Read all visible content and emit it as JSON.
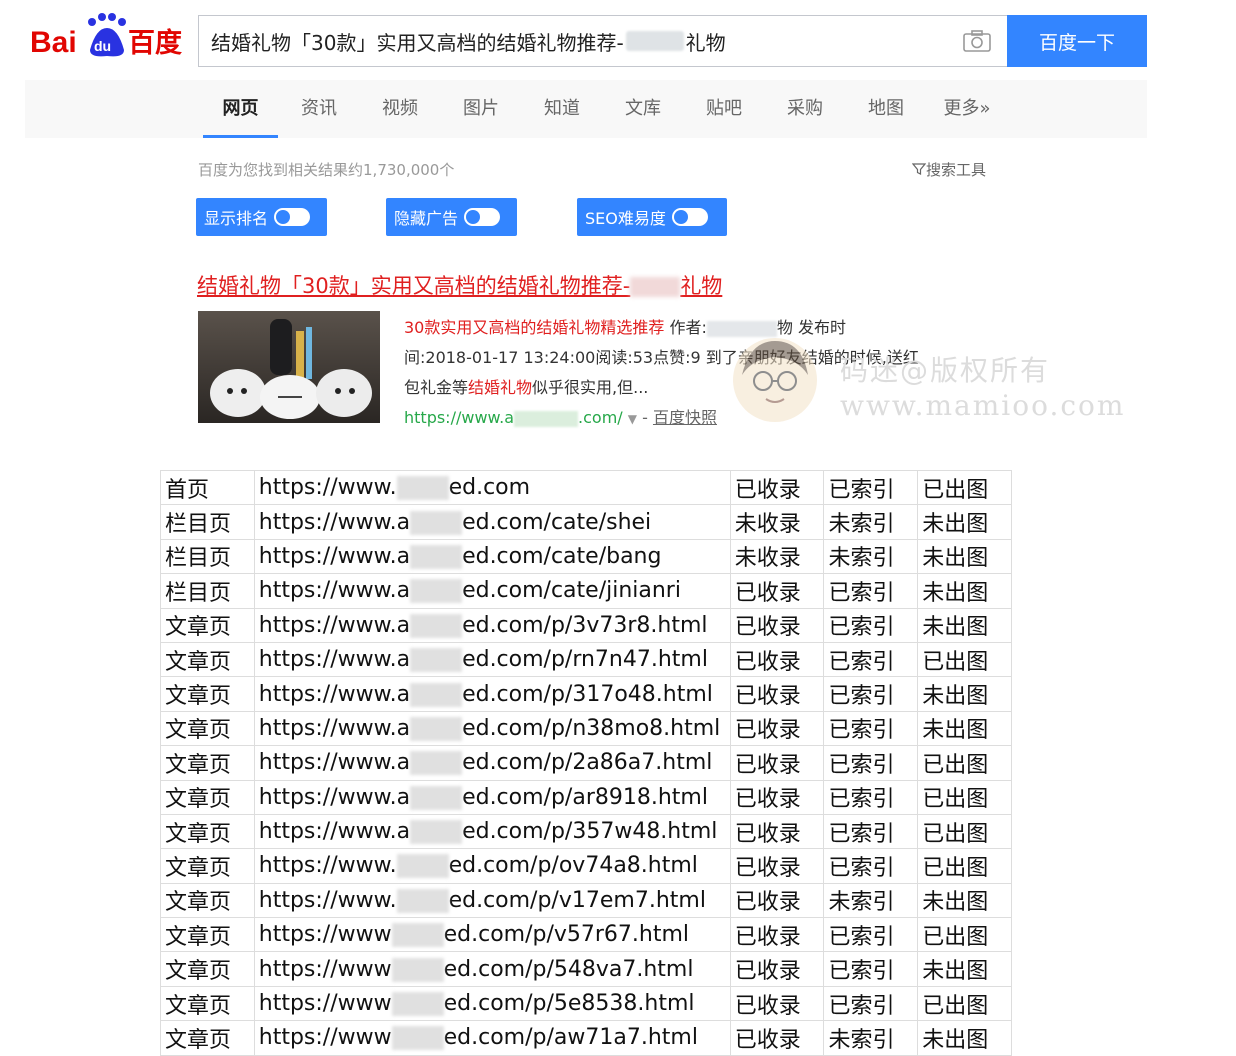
{
  "search": {
    "query_prefix": "结婚礼物「30款」实用又高档的结婚礼物推荐-",
    "query_suffix": "礼物",
    "button_label": "百度一下"
  },
  "tabs": [
    "网页",
    "资讯",
    "视频",
    "图片",
    "知道",
    "文库",
    "贴吧",
    "采购",
    "地图",
    "更多»"
  ],
  "active_tab": "网页",
  "stats": {
    "result_count": "百度为您找到相关结果约1,730,000个",
    "search_tools": "搜索工具"
  },
  "toggles": [
    "显示排名",
    "隐藏广告",
    "SEO难易度"
  ],
  "result": {
    "title_prefix": "结婚礼物「30款」实用又高档的结婚礼物推荐-",
    "title_suffix": "礼物",
    "abs_hl1": "30款实用又高档的结婚礼物精选推荐",
    "abs_author": " 作者:",
    "abs_author_tail": "物 发布时",
    "abs_line2": "间:2018-01-17 13:24:00阅读:53点赞:9 到了亲朋好友结婚的时候,送红",
    "abs_line3_a": "包礼金等",
    "abs_hl2": "结婚礼物",
    "abs_line3_b": "似乎很实用,但...",
    "url_prefix": "https://www.a",
    "url_suffix": ".com/",
    "snapshot": "百度快照"
  },
  "watermark": {
    "line1": "码迷@版权所有",
    "line2": "www.mamioo.com"
  },
  "table": {
    "rows": [
      {
        "type": "首页",
        "url_a": "https://www.",
        "url_b": "ed.com",
        "included": "已收录",
        "indexed": "已索引",
        "image": "已出图"
      },
      {
        "type": "栏目页",
        "url_a": "https://www.a",
        "url_b": "ed.com/cate/shei",
        "included": "未收录",
        "indexed": "未索引",
        "image": "未出图"
      },
      {
        "type": "栏目页",
        "url_a": "https://www.a",
        "url_b": "ed.com/cate/bang",
        "included": "未收录",
        "indexed": "未索引",
        "image": "未出图"
      },
      {
        "type": "栏目页",
        "url_a": "https://www.a",
        "url_b": "ed.com/cate/jinianri",
        "included": "已收录",
        "indexed": "已索引",
        "image": "未出图"
      },
      {
        "type": "文章页",
        "url_a": "https://www.a",
        "url_b": "ed.com/p/3v73r8.html",
        "included": "已收录",
        "indexed": "已索引",
        "image": "未出图"
      },
      {
        "type": "文章页",
        "url_a": "https://www.a",
        "url_b": "ed.com/p/rn7n47.html",
        "included": "已收录",
        "indexed": "已索引",
        "image": "已出图"
      },
      {
        "type": "文章页",
        "url_a": "https://www.a",
        "url_b": "ed.com/p/317o48.html",
        "included": "已收录",
        "indexed": "已索引",
        "image": "未出图"
      },
      {
        "type": "文章页",
        "url_a": "https://www.a",
        "url_b": "ed.com/p/n38mo8.html",
        "included": "已收录",
        "indexed": "已索引",
        "image": "未出图"
      },
      {
        "type": "文章页",
        "url_a": "https://www.a",
        "url_b": "ed.com/p/2a86a7.html",
        "included": "已收录",
        "indexed": "已索引",
        "image": "已出图"
      },
      {
        "type": "文章页",
        "url_a": "https://www.a",
        "url_b": "ed.com/p/ar8918.html",
        "included": "已收录",
        "indexed": "已索引",
        "image": "已出图"
      },
      {
        "type": "文章页",
        "url_a": "https://www.a",
        "url_b": "ed.com/p/357w48.html",
        "included": "已收录",
        "indexed": "已索引",
        "image": "已出图"
      },
      {
        "type": "文章页",
        "url_a": "https://www.",
        "url_b": "ed.com/p/ov74a8.html",
        "included": "已收录",
        "indexed": "已索引",
        "image": "已出图"
      },
      {
        "type": "文章页",
        "url_a": "https://www.",
        "url_b": "ed.com/p/v17em7.html",
        "included": "已收录",
        "indexed": "未索引",
        "image": "未出图"
      },
      {
        "type": "文章页",
        "url_a": "https://www",
        "url_b": "ed.com/p/v57r67.html",
        "included": "已收录",
        "indexed": "已索引",
        "image": "已出图"
      },
      {
        "type": "文章页",
        "url_a": "https://www",
        "url_b": "ed.com/p/548va7.html",
        "included": "已收录",
        "indexed": "已索引",
        "image": "未出图"
      },
      {
        "type": "文章页",
        "url_a": "https://www",
        "url_b": "ed.com/p/5e8538.html",
        "included": "已收录",
        "indexed": "已索引",
        "image": "已出图"
      },
      {
        "type": "文章页",
        "url_a": "https://www",
        "url_b": "ed.com/p/aw71a7.html",
        "included": "已收录",
        "indexed": "未索引",
        "image": "未出图"
      }
    ]
  },
  "colors": {
    "accent": "#3385ff",
    "title_red": "#e02020",
    "url_green": "#27a84a",
    "tab_bar_bg": "#f8f8f8"
  }
}
